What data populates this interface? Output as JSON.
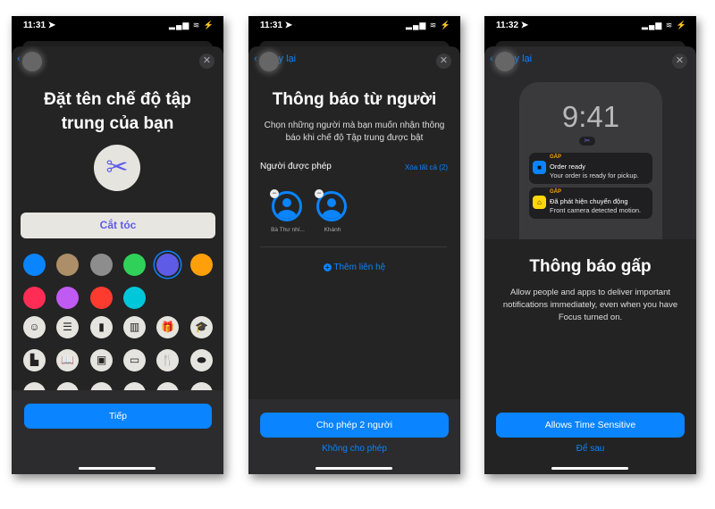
{
  "screens": [
    {
      "status": {
        "time": "11:31 ➤",
        "signal": "▂▄▆ ≋ ⚡"
      },
      "title_line1": "Đặt tên chế độ tập",
      "title_line2": "trung của bạn",
      "focus_icon": "scissors-icon",
      "focus_name": "Cắt tóc",
      "focus_color": "#5e5ce6",
      "colors": [
        "#0a84ff",
        "#ac8e68",
        "#8e8d8d",
        "#30d158",
        "#5e5ce6",
        "#ff9f0a",
        "#ff2d55",
        "#bf5af2",
        "#ff3b30",
        "#00c7d9"
      ],
      "selected_color_index": 4,
      "icons": [
        {
          "name": "smiley",
          "glyph": "☺"
        },
        {
          "name": "list",
          "glyph": "☰"
        },
        {
          "name": "bookmark",
          "glyph": "▮"
        },
        {
          "name": "books",
          "glyph": "▥"
        },
        {
          "name": "gift",
          "glyph": "🎁"
        },
        {
          "name": "graduation-cap",
          "glyph": "🎓"
        },
        {
          "name": "document",
          "glyph": "▙"
        },
        {
          "name": "book",
          "glyph": "📖"
        },
        {
          "name": "briefcase",
          "glyph": "▣"
        },
        {
          "name": "credit-card",
          "glyph": "▭"
        },
        {
          "name": "fork-knife",
          "glyph": "🍴"
        },
        {
          "name": "pills",
          "glyph": "⬬"
        }
      ],
      "next_button": "Tiếp"
    },
    {
      "status": {
        "time": "11:31 ➤",
        "signal": "▂▄▆ ≋ ⚡"
      },
      "back": "Quay lại",
      "title": "Thông báo từ người",
      "subtitle_line1": "Chọn những người mà bạn muốn nhận thông",
      "subtitle_line2": "báo khi chế độ Tập trung được bật",
      "section_label": "Người được phép",
      "clear_all": "Xóa tất cả (2)",
      "people": [
        {
          "name": "Bà Thư nhí..."
        },
        {
          "name": "Khánh"
        }
      ],
      "add_contact": "Thêm liên hệ",
      "primary_button": "Cho phép 2 người",
      "secondary_button": "Không cho phép"
    },
    {
      "status": {
        "time": "11:32 ➤",
        "signal": "▂▄▆ ≋ ⚡"
      },
      "back": "Quay lại",
      "preview": {
        "clock": "9:41",
        "notifications": [
          {
            "tag": "GẤP",
            "title": "Order ready",
            "body": "Your order is ready for pickup.",
            "icon": "bag-icon",
            "color": "#0a84ff"
          },
          {
            "tag": "GẤP",
            "title": "Đã phát hiện chuyển động",
            "body": "Front camera detected motion.",
            "icon": "home-icon",
            "color": "#ffd60a"
          }
        ]
      },
      "title": "Thông báo gấp",
      "desc_line1": "Allow people and apps to deliver important",
      "desc_line2": "notifications immediately, even when you have",
      "desc_line3": "Focus turned on.",
      "primary_button": "Allows Time Sensitive",
      "secondary_button": "Để sau"
    }
  ]
}
